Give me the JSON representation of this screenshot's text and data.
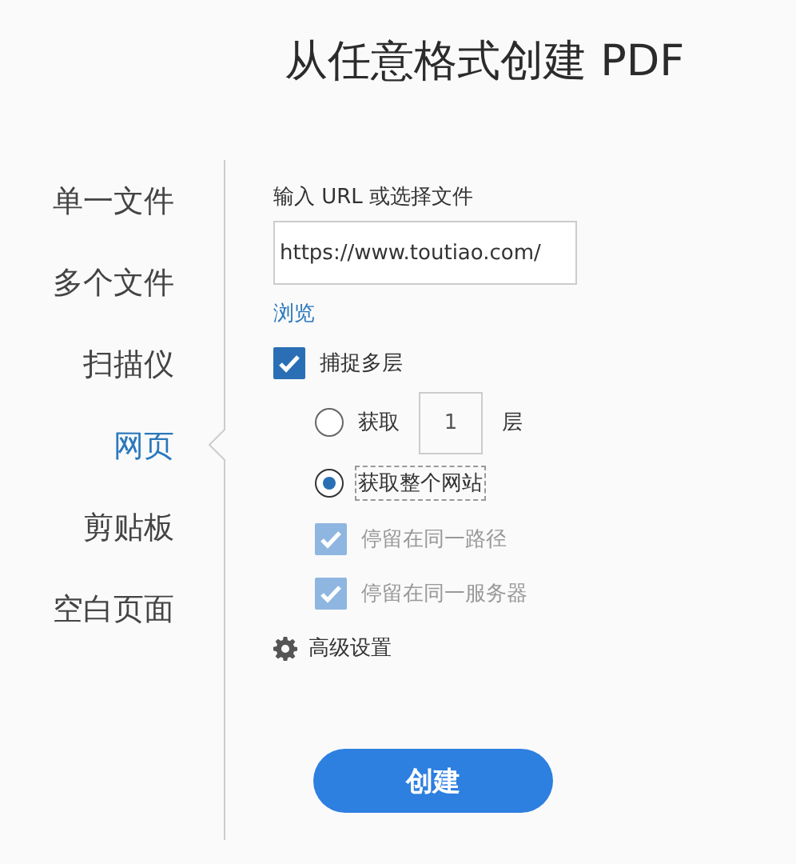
{
  "title": "从任意格式创建 PDF",
  "sidebar": {
    "items": [
      {
        "label": "单一文件",
        "selected": false
      },
      {
        "label": "多个文件",
        "selected": false
      },
      {
        "label": "扫描仪",
        "selected": false
      },
      {
        "label": "网页",
        "selected": true
      },
      {
        "label": "剪贴板",
        "selected": false
      },
      {
        "label": "空白页面",
        "selected": false
      }
    ]
  },
  "form": {
    "url_label": "输入 URL 或选择文件",
    "url_field": {
      "value": "https://www.toutiao.com/"
    },
    "browse_link": "浏览",
    "capture_multiple": {
      "label": "捕捉多层",
      "checked": true
    },
    "options": [
      {
        "label": "获取",
        "selected": false,
        "levels_field": {
          "value": "1"
        },
        "suffix": "层"
      },
      {
        "label": "获取整个网站",
        "selected": true
      }
    ],
    "limits": [
      {
        "label": "停留在同一路径",
        "checked": true,
        "disabled": true
      },
      {
        "label": "停留在同一服务器",
        "checked": true,
        "disabled": true
      }
    ],
    "advanced_settings": "高级设置",
    "create_button": "创建"
  }
}
